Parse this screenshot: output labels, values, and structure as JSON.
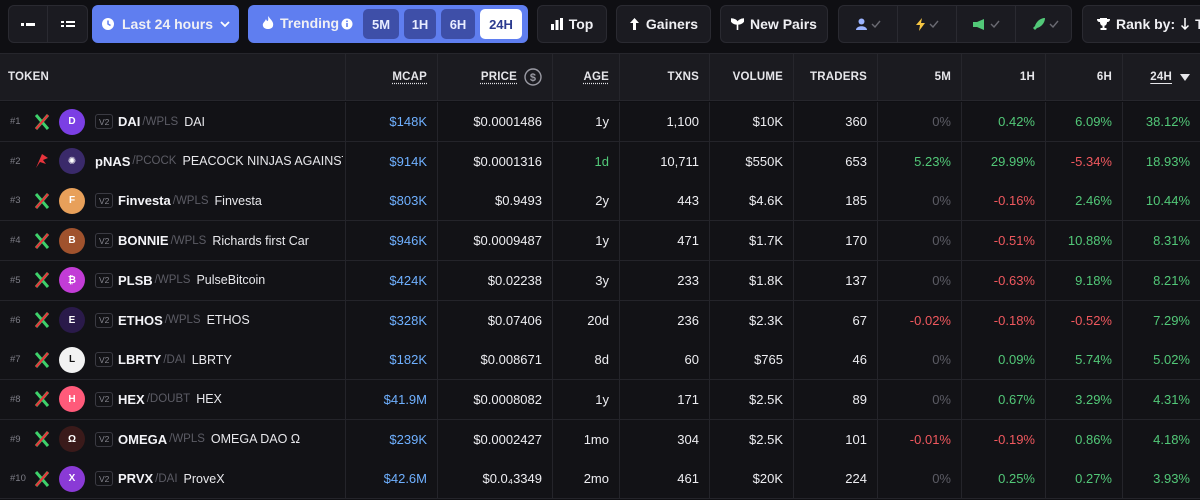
{
  "toolbar": {
    "view_grid_icon": "grid-view-icon",
    "view_list_icon": "list-view-icon",
    "timeframe_label": "Last 24 hours",
    "trending_label": "Trending",
    "trending_tabs": [
      "5M",
      "1H",
      "6H",
      "24H"
    ],
    "trending_active": "24H",
    "top_label": "Top",
    "gainers_label": "Gainers",
    "new_pairs_label": "New Pairs",
    "rank_label": "Rank by:",
    "rank_value": "Tr",
    "filter_icons": [
      "user-icon",
      "bolt-icon",
      "megaphone-icon",
      "rocket-icon"
    ],
    "accent_color": "#5f7ef0"
  },
  "table": {
    "headers": {
      "token": "TOKEN",
      "mcap": "MCAP",
      "price": "PRICE",
      "age": "AGE",
      "txns": "TXNS",
      "volume": "VOLUME",
      "traders": "TRADERS",
      "m5": "5M",
      "h1": "1H",
      "h6": "6H",
      "h24": "24H"
    },
    "rows": [
      {
        "rank": "#1",
        "ver": "V2",
        "symbol": "DAI",
        "quote": "/WPLS",
        "name": "DAI",
        "mcap": "$148K",
        "price": "$0.0001486",
        "age": "1y",
        "txns": "1,100",
        "volume": "$10K",
        "traders": "360",
        "m5": "0%",
        "h1": "0.42%",
        "h6": "6.09%",
        "h24": "38.12%",
        "logo_color": "#7b3fe4",
        "logo_text": "D"
      },
      {
        "rank": "#2",
        "ver": "",
        "symbol": "pNAS",
        "quote": "/PCOCK",
        "name": "PEACOCK NINJAS AGAINST",
        "mcap": "$914K",
        "price": "$0.0001316",
        "age": "1d",
        "txns": "10,711",
        "volume": "$550K",
        "traders": "653",
        "m5": "5.23%",
        "h1": "29.99%",
        "h6": "-5.34%",
        "h24": "18.93%",
        "logo_color": "#3a2a6a",
        "logo_text": "✺"
      },
      {
        "rank": "#3",
        "ver": "V2",
        "symbol": "Finvesta",
        "quote": "/WPLS",
        "name": "Finvesta",
        "mcap": "$803K",
        "price": "$0.9493",
        "age": "2y",
        "txns": "443",
        "volume": "$4.6K",
        "traders": "185",
        "m5": "0%",
        "h1": "-0.16%",
        "h6": "2.46%",
        "h24": "10.44%",
        "logo_color": "#e8a05a",
        "logo_text": "F"
      },
      {
        "rank": "#4",
        "ver": "V2",
        "symbol": "BONNIE",
        "quote": "/WPLS",
        "name": "Richards first Car",
        "mcap": "$946K",
        "price": "$0.0009487",
        "age": "1y",
        "txns": "471",
        "volume": "$1.7K",
        "traders": "170",
        "m5": "0%",
        "h1": "-0.51%",
        "h6": "10.88%",
        "h24": "8.31%",
        "logo_color": "#a0522d",
        "logo_text": "B"
      },
      {
        "rank": "#5",
        "ver": "V2",
        "symbol": "PLSB",
        "quote": "/WPLS",
        "name": "PulseBitcoin",
        "mcap": "$424K",
        "price": "$0.02238",
        "age": "3y",
        "txns": "233",
        "volume": "$1.8K",
        "traders": "137",
        "m5": "0%",
        "h1": "-0.63%",
        "h6": "9.18%",
        "h24": "8.21%",
        "logo_color": "#c23cd6",
        "logo_text": "₿"
      },
      {
        "rank": "#6",
        "ver": "V2",
        "symbol": "ETHOS",
        "quote": "/WPLS",
        "name": "ETHOS",
        "mcap": "$328K",
        "price": "$0.07406",
        "age": "20d",
        "txns": "236",
        "volume": "$2.3K",
        "traders": "67",
        "m5": "-0.02%",
        "h1": "-0.18%",
        "h6": "-0.52%",
        "h24": "7.29%",
        "logo_color": "#2a1a4a",
        "logo_text": "E"
      },
      {
        "rank": "#7",
        "ver": "V2",
        "symbol": "LBRTY",
        "quote": "/DAI",
        "name": "LBRTY",
        "mcap": "$182K",
        "price": "$0.008671",
        "age": "8d",
        "txns": "60",
        "volume": "$765",
        "traders": "46",
        "m5": "0%",
        "h1": "0.09%",
        "h6": "5.74%",
        "h24": "5.02%",
        "logo_color": "#f2f2f2",
        "logo_text": "L"
      },
      {
        "rank": "#8",
        "ver": "V2",
        "symbol": "HEX",
        "quote": "/DOUBT",
        "name": "HEX",
        "mcap": "$41.9M",
        "price": "$0.0008082",
        "age": "1y",
        "txns": "171",
        "volume": "$2.5K",
        "traders": "89",
        "m5": "0%",
        "h1": "0.67%",
        "h6": "3.29%",
        "h24": "4.31%",
        "logo_color": "#ff5a7a",
        "logo_text": "H"
      },
      {
        "rank": "#9",
        "ver": "V2",
        "symbol": "OMEGA",
        "quote": "/WPLS",
        "name": "OMEGA DAO Ω",
        "mcap": "$239K",
        "price": "$0.0002427",
        "age": "1mo",
        "txns": "304",
        "volume": "$2.5K",
        "traders": "101",
        "m5": "-0.01%",
        "h1": "-0.19%",
        "h6": "0.86%",
        "h24": "4.18%",
        "logo_color": "#3a1a1a",
        "logo_text": "Ω"
      },
      {
        "rank": "#10",
        "ver": "V2",
        "symbol": "PRVX",
        "quote": "/DAI",
        "name": "ProveX",
        "mcap": "$42.6M",
        "price": "$0.0₄3349",
        "age": "2mo",
        "txns": "461",
        "volume": "$20K",
        "traders": "224",
        "m5": "0%",
        "h1": "0.25%",
        "h6": "0.27%",
        "h24": "3.93%",
        "logo_color": "#8a3ad6",
        "logo_text": "X"
      }
    ]
  }
}
